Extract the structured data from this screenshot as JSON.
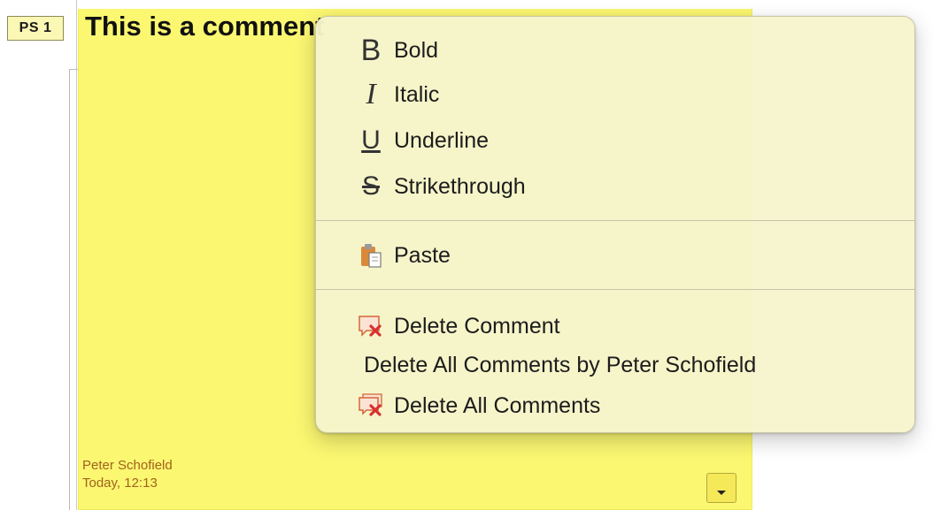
{
  "comment": {
    "author_tag": "PS 1",
    "text": "This is a comment",
    "author": "Peter Schofield",
    "date": "Today, 12:13",
    "menu_button_icon": "chevron-down-icon"
  },
  "context_menu": {
    "format_items": [
      {
        "label": "Bold",
        "icon": "bold-icon",
        "glyph": "B"
      },
      {
        "label": "Italic",
        "icon": "italic-icon",
        "glyph": "I"
      },
      {
        "label": "Underline",
        "icon": "underline-icon",
        "glyph": "U"
      },
      {
        "label": "Strikethrough",
        "icon": "strikethrough-icon",
        "glyph": "S"
      }
    ],
    "paste": {
      "label": "Paste",
      "icon": "paste-icon"
    },
    "delete_items": [
      {
        "label": "Delete Comment",
        "icon": "delete-comment-icon"
      },
      {
        "label": "Delete All Comments by Peter Schofield",
        "icon": ""
      },
      {
        "label": "Delete All Comments",
        "icon": "delete-all-comments-icon"
      }
    ]
  }
}
